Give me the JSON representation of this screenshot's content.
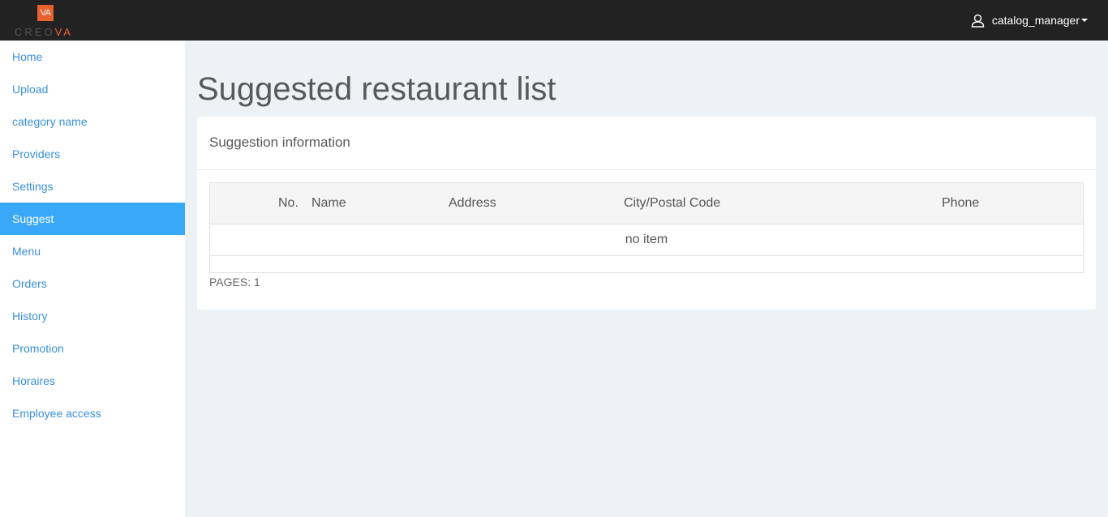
{
  "brand": {
    "mark": "VA",
    "name_a": "CREO",
    "name_b": "VA"
  },
  "header": {
    "username": "catalog_manager"
  },
  "sidebar": {
    "items": [
      {
        "label": "Home"
      },
      {
        "label": "Upload"
      },
      {
        "label": "category name"
      },
      {
        "label": "Providers"
      },
      {
        "label": "Settings"
      },
      {
        "label": "Suggest",
        "active": true
      },
      {
        "label": "Menu"
      },
      {
        "label": "Orders"
      },
      {
        "label": "History"
      },
      {
        "label": "Promotion"
      },
      {
        "label": "Horaires"
      },
      {
        "label": "Employee access"
      }
    ]
  },
  "main": {
    "title": "Suggested restaurant list",
    "panel_title": "Suggestion information",
    "table": {
      "columns": [
        "No.",
        "Name",
        "Address",
        "City/Postal Code",
        "Phone"
      ],
      "empty_text": "no item"
    },
    "pagination": "PAGES: 1"
  },
  "colors": {
    "topbar": "#222222",
    "accent": "#3aa8f8",
    "brand": "#e8602c",
    "link": "#3a8fd8"
  }
}
